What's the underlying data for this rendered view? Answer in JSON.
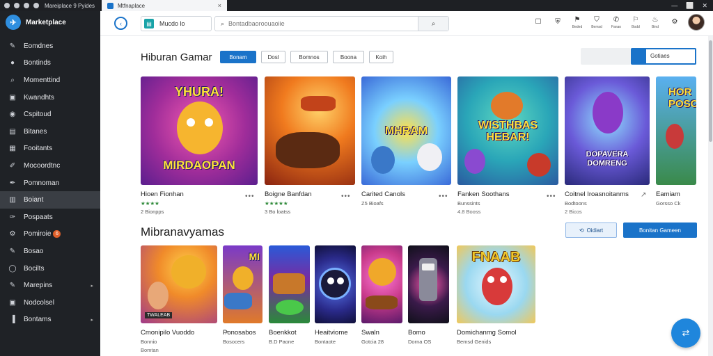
{
  "os_bar": {
    "title": "Mareiplace 9 Pyides",
    "tab_label": "Mtfnaplace",
    "tab_close": "×",
    "right_glyphs": [
      "—",
      "⬜",
      "✕"
    ]
  },
  "sidebar": {
    "brand": "Marketplace",
    "items": [
      {
        "label": "Eomdnes",
        "icon": "pin-icon",
        "glyph": "✎"
      },
      {
        "label": "Bontinds",
        "icon": "globe-icon",
        "glyph": "●"
      },
      {
        "label": "Momenttind",
        "icon": "search-icon",
        "glyph": "⌕"
      },
      {
        "label": "Kwandhts",
        "icon": "app-icon",
        "glyph": "▣"
      },
      {
        "label": "Cspitoud",
        "icon": "gamepad-icon",
        "glyph": "◉"
      },
      {
        "label": "Bitanes",
        "icon": "document-icon",
        "glyph": "▤"
      },
      {
        "label": "Fooitants",
        "icon": "grid-icon",
        "glyph": "▦"
      },
      {
        "label": "Mocoordtnc",
        "icon": "tool-icon",
        "glyph": "✐"
      },
      {
        "label": "Pomnoman",
        "icon": "pen-icon",
        "glyph": "✒"
      },
      {
        "label": "Boiant",
        "icon": "folder-icon",
        "glyph": "▥"
      },
      {
        "label": "Pospaats",
        "icon": "feather-icon",
        "glyph": "✑"
      },
      {
        "label": "Pomiroie",
        "icon": "settings-icon",
        "glyph": "⚙",
        "badge": "6"
      },
      {
        "label": "Bosao",
        "icon": "link-icon",
        "glyph": "✎"
      },
      {
        "label": "Bocilts",
        "icon": "circle-icon",
        "glyph": "◯"
      },
      {
        "label": "Marepins",
        "icon": "brush-icon",
        "glyph": "✎"
      },
      {
        "label": "Nodcolsel",
        "icon": "window-icon",
        "glyph": "▣"
      },
      {
        "label": "Bontams",
        "icon": "bars-icon",
        "glyph": "▐"
      }
    ]
  },
  "topbar": {
    "back_glyph": "‹",
    "breadcrumb": "Mucdo lo",
    "search_placeholder": "Bontadbaoroouaoiie",
    "search_glyph": "⌕",
    "actions": [
      {
        "label": "",
        "icon": "square-icon",
        "glyph": "☐"
      },
      {
        "label": "",
        "icon": "shield-icon",
        "glyph": "⛨"
      },
      {
        "label": "Beded",
        "icon": "alert-icon",
        "glyph": "⚑"
      },
      {
        "label": "Bemsd",
        "icon": "shield-check-icon",
        "glyph": "⛉"
      },
      {
        "label": "Fanao",
        "icon": "chat-icon",
        "glyph": "✆"
      },
      {
        "label": "Bodd",
        "icon": "bell-icon",
        "glyph": "⚐"
      },
      {
        "label": "Bind",
        "icon": "fire-icon",
        "glyph": "♨"
      },
      {
        "label": "",
        "icon": "settings-icon",
        "glyph": "⚙"
      }
    ]
  },
  "section1": {
    "title": "Hiburan Gamar",
    "chips": [
      "Bonam",
      "Dosl",
      "Bomnos",
      "Boona",
      "Koih"
    ],
    "sort_label": "Gotiaes",
    "cards": [
      {
        "title": "Hioen Fionhan",
        "rating": "★★★★",
        "sub": "2 Bionpps",
        "art": "YHURA! MIRDAOPAN"
      },
      {
        "title": "Boigne Banfdan",
        "rating": "★★★★★",
        "sub": "3 Bo loatss",
        "art": ""
      },
      {
        "title": "Carited Canols",
        "rating": "",
        "sub": "Z5 Bioafs",
        "art": "MHRAM"
      },
      {
        "title": "Fanken Soothans",
        "rating": "",
        "sub": "Bunssints",
        "sub2": "4.8 Booss",
        "art": "WISTHBAS HEBAR!"
      },
      {
        "title": "Coitnel Iroasnoitanms",
        "rating": "",
        "sub": "Bodtoons",
        "sub2": "2 Bicos",
        "art": "DOPAVERA DOMRENG"
      },
      {
        "title": "Eamiam",
        "rating": "",
        "sub": "Gorsso Ck",
        "art": "HOR POSC"
      }
    ]
  },
  "section2": {
    "title": "Mibranavyamas",
    "outline_button": "Oidiart",
    "solid_button": "Bonitan Gameen",
    "cards": [
      {
        "title": "Cmonipilo Vuoddo",
        "sub": "Bonnio",
        "sub2": "Bomtan",
        "tag": "TWALEAB"
      },
      {
        "title": "Ponosabos",
        "sub": "Bosocers"
      },
      {
        "title": "Boenkkot",
        "sub": "B.D Paone"
      },
      {
        "title": "Heaitviome",
        "sub": "Bontaote"
      },
      {
        "title": "Swaln",
        "sub": "Gotcia 28"
      },
      {
        "title": "Bomo",
        "sub": "Dorna OS"
      },
      {
        "title": "Domichanmg Somol",
        "sub": "Bemsd Genids",
        "art": "FNAAB"
      }
    ]
  },
  "fab_glyph": "⇄",
  "colors": {
    "accent": "#1a73c9",
    "sidebar_bg": "#1f2226",
    "badge": "#e0602a"
  }
}
